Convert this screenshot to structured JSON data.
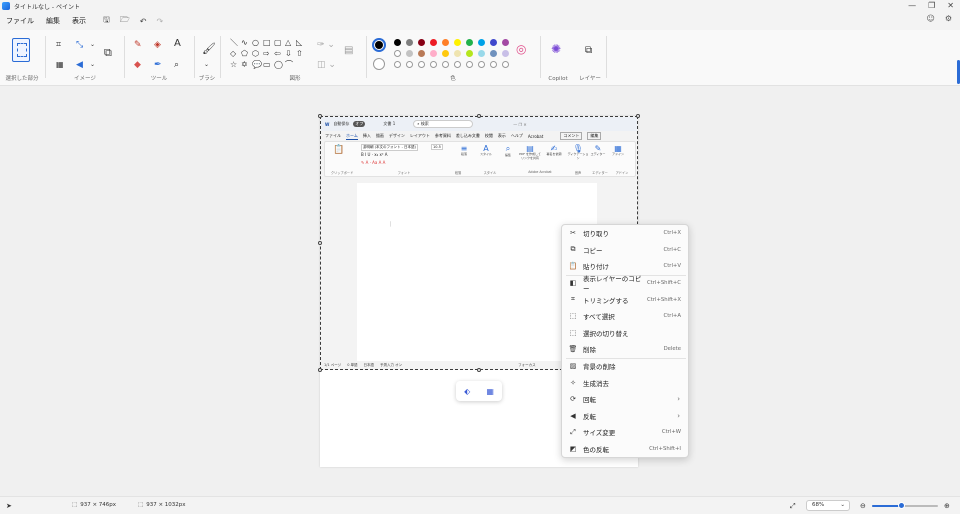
{
  "window": {
    "title": "タイトルなし - ペイント",
    "controls": [
      "—",
      "❐",
      "✕"
    ]
  },
  "menu": {
    "items": [
      "ファイル",
      "編集",
      "表示"
    ],
    "quick": [
      "🖫",
      "🗁",
      "↶",
      "↷"
    ]
  },
  "topright": [
    "☺",
    "⚙"
  ],
  "ribbon": {
    "groups": [
      {
        "label": "選択した部分"
      },
      {
        "label": "イメージ"
      },
      {
        "label": "ツール"
      },
      {
        "label": "ブラシ"
      },
      {
        "label": "図形"
      },
      {
        "label": "色"
      },
      {
        "label": "Copilot"
      },
      {
        "label": "レイヤー"
      }
    ],
    "shape_glyphs": [
      "＼",
      "∿",
      "○",
      "□",
      "▢",
      "△",
      "◺",
      "◇",
      "⬠",
      "⬡",
      "⇨",
      "⇦",
      "⇩",
      "⇧",
      "☆",
      "✡",
      "💬",
      "▭",
      "◯",
      "⌒"
    ],
    "colors_row1": [
      "#000000",
      "#7f7f7f",
      "#880015",
      "#ed1c24",
      "#ff7f27",
      "#fff200",
      "#22b14c",
      "#00a2e8",
      "#3f48cc",
      "#a349a4"
    ],
    "colors_row2": [
      "#ffffff",
      "#c3c3c3",
      "#b97a57",
      "#ffaec9",
      "#ffc90e",
      "#efe4b0",
      "#b5e61d",
      "#99d9ea",
      "#7092be",
      "#c8bfe7"
    ],
    "primary_color": "#000000"
  },
  "pasted_word": {
    "autosave": "自動保存",
    "autosave_state": "オフ",
    "doc_name": "文書 1",
    "search": "検索",
    "tabs": [
      "ファイル",
      "ホーム",
      "挿入",
      "描画",
      "デザイン",
      "レイアウト",
      "参考資料",
      "差し込み文書",
      "校閲",
      "表示",
      "ヘルプ",
      "Acrobat"
    ],
    "comment_btn": "コメント",
    "edit_btn": "編集",
    "font_name": "游明朝 (本文のフォント - 日本語)",
    "font_size": "10.5",
    "ribbon_items": [
      "段落",
      "スタイル",
      "編集",
      "PDF を作成してリンクを共有",
      "署名を依頼",
      "ディクテーション",
      "エディター",
      "アドイン"
    ],
    "ribbon_labels": [
      "クリップボード",
      "フォント",
      "段落",
      "スタイル",
      "Adobe Acrobat",
      "音声",
      "エディター",
      "アドイン"
    ],
    "status": [
      "1/1 ページ",
      "0 単語",
      "日本語",
      "予測入力 オン"
    ],
    "focus": "フォーカス"
  },
  "float_toolbar": [
    "⬖",
    "▦"
  ],
  "context_menu": [
    {
      "icon": "✂",
      "label": "切り取り",
      "shortcut": "Ctrl+X"
    },
    {
      "icon": "⧉",
      "label": "コピー",
      "shortcut": "Ctrl+C"
    },
    {
      "icon": "📋",
      "label": "貼り付け",
      "shortcut": "Ctrl+V"
    },
    {
      "icon": "◧",
      "label": "表示レイヤーのコピー",
      "shortcut": "Ctrl+Shift+C"
    },
    {
      "icon": "⌗",
      "label": "トリミングする",
      "shortcut": "Ctrl+Shift+X"
    },
    {
      "icon": "⬚",
      "label": "すべて選択",
      "shortcut": "Ctrl+A"
    },
    {
      "icon": "⬚",
      "label": "選択の切り替え",
      "shortcut": ""
    },
    {
      "icon": "🗑",
      "label": "削除",
      "shortcut": "Delete"
    },
    {
      "icon": "▨",
      "label": "背景の削除",
      "shortcut": ""
    },
    {
      "icon": "✧",
      "label": "生成消去",
      "shortcut": ""
    },
    {
      "icon": "⟳",
      "label": "回転",
      "shortcut": "",
      "submenu": "›"
    },
    {
      "icon": "◀",
      "label": "反転",
      "shortcut": "",
      "submenu": "›"
    },
    {
      "icon": "⤢",
      "label": "サイズ変更",
      "shortcut": "Ctrl+W"
    },
    {
      "icon": "◩",
      "label": "色の反転",
      "shortcut": "Ctrl+Shift+I"
    }
  ],
  "statusbar": {
    "pointer_icon": "➤",
    "selection_size": "937 × 746px",
    "canvas_size": "937 × 1032px",
    "zoom": "68%",
    "zoom_fraction": 0.45
  }
}
